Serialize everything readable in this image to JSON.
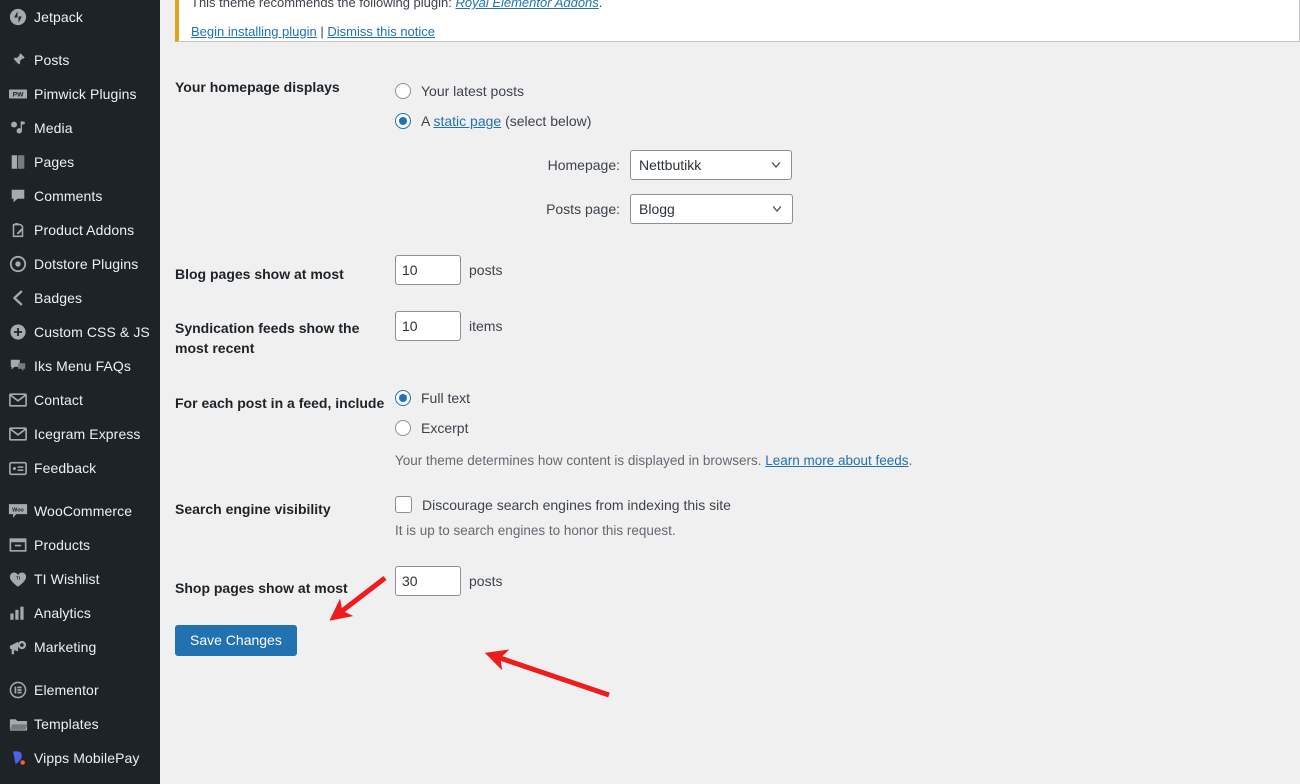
{
  "sidebar": {
    "items": [
      {
        "label": "Jetpack",
        "icon": "jetpack-icon"
      },
      {
        "label": "Posts",
        "icon": "pin-icon",
        "gap_before": true
      },
      {
        "label": "Pimwick Plugins",
        "icon": "pimwick-icon"
      },
      {
        "label": "Media",
        "icon": "media-icon"
      },
      {
        "label": "Pages",
        "icon": "pages-icon"
      },
      {
        "label": "Comments",
        "icon": "comments-icon"
      },
      {
        "label": "Product Addons",
        "icon": "product-addons-icon"
      },
      {
        "label": "Dotstore Plugins",
        "icon": "dotstore-icon"
      },
      {
        "label": "Badges",
        "icon": "badges-icon"
      },
      {
        "label": "Custom CSS & JS",
        "icon": "custom-css-js-icon"
      },
      {
        "label": "Iks Menu FAQs",
        "icon": "faq-icon"
      },
      {
        "label": "Contact",
        "icon": "envelope-icon"
      },
      {
        "label": "Icegram Express",
        "icon": "envelope-icon"
      },
      {
        "label": "Feedback",
        "icon": "feedback-icon"
      },
      {
        "label": "WooCommerce",
        "icon": "woocommerce-icon",
        "gap_before": true
      },
      {
        "label": "Products",
        "icon": "products-icon"
      },
      {
        "label": "TI Wishlist",
        "icon": "wishlist-heart-icon"
      },
      {
        "label": "Analytics",
        "icon": "analytics-bars-icon"
      },
      {
        "label": "Marketing",
        "icon": "megaphone-icon"
      },
      {
        "label": "Elementor",
        "icon": "elementor-icon",
        "gap_before": true
      },
      {
        "label": "Templates",
        "icon": "folder-icon"
      },
      {
        "label": "Vipps MobilePay",
        "icon": "vipps-icon"
      }
    ]
  },
  "notice": {
    "line1_prefix": "This theme recommends the following plugin: ",
    "line1_link": "Royal Elementor Addons",
    "line1_suffix": ".",
    "install_link": "Begin installing plugin",
    "separator": " | ",
    "dismiss_link": "Dismiss this notice"
  },
  "settings": {
    "homepage_displays": {
      "label": "Your homepage displays",
      "option_latest": "Your latest posts",
      "option_static_prefix": "A ",
      "option_static_link": "static page",
      "option_static_suffix": " (select below)",
      "selected": "static",
      "homepage_label": "Homepage:",
      "homepage_value": "Nettbutikk",
      "posts_page_label": "Posts page:",
      "posts_page_value": "Blogg"
    },
    "blog_pages": {
      "label": "Blog pages show at most",
      "value": "10",
      "unit": "posts"
    },
    "syndication": {
      "label": "Syndication feeds show the most recent",
      "value": "10",
      "unit": "items"
    },
    "feed_include": {
      "label": "For each post in a feed, include",
      "option_full": "Full text",
      "option_excerpt": "Excerpt",
      "selected": "full",
      "help_text": "Your theme determines how content is displayed in browsers. ",
      "help_link": "Learn more about feeds",
      "help_suffix": "."
    },
    "search_visibility": {
      "label": "Search engine visibility",
      "checkbox_label": "Discourage search engines from indexing this site",
      "checked": false,
      "help_text": "It is up to search engines to honor this request."
    },
    "shop_pages": {
      "label": "Shop pages show at most",
      "value": "30",
      "unit": "posts"
    },
    "save_label": "Save Changes"
  },
  "colors": {
    "sidebar_bg": "#1d2327",
    "content_bg": "#f0f0f1",
    "accent_blue": "#2271b1",
    "notice_border": "#dba617",
    "annotation_red": "#ee1c1c"
  },
  "annotations": {
    "arrow_1": "arrow pointing down-left at Shop pages show at most label",
    "arrow_2": "arrow pointing up-left at shop pages value field"
  }
}
